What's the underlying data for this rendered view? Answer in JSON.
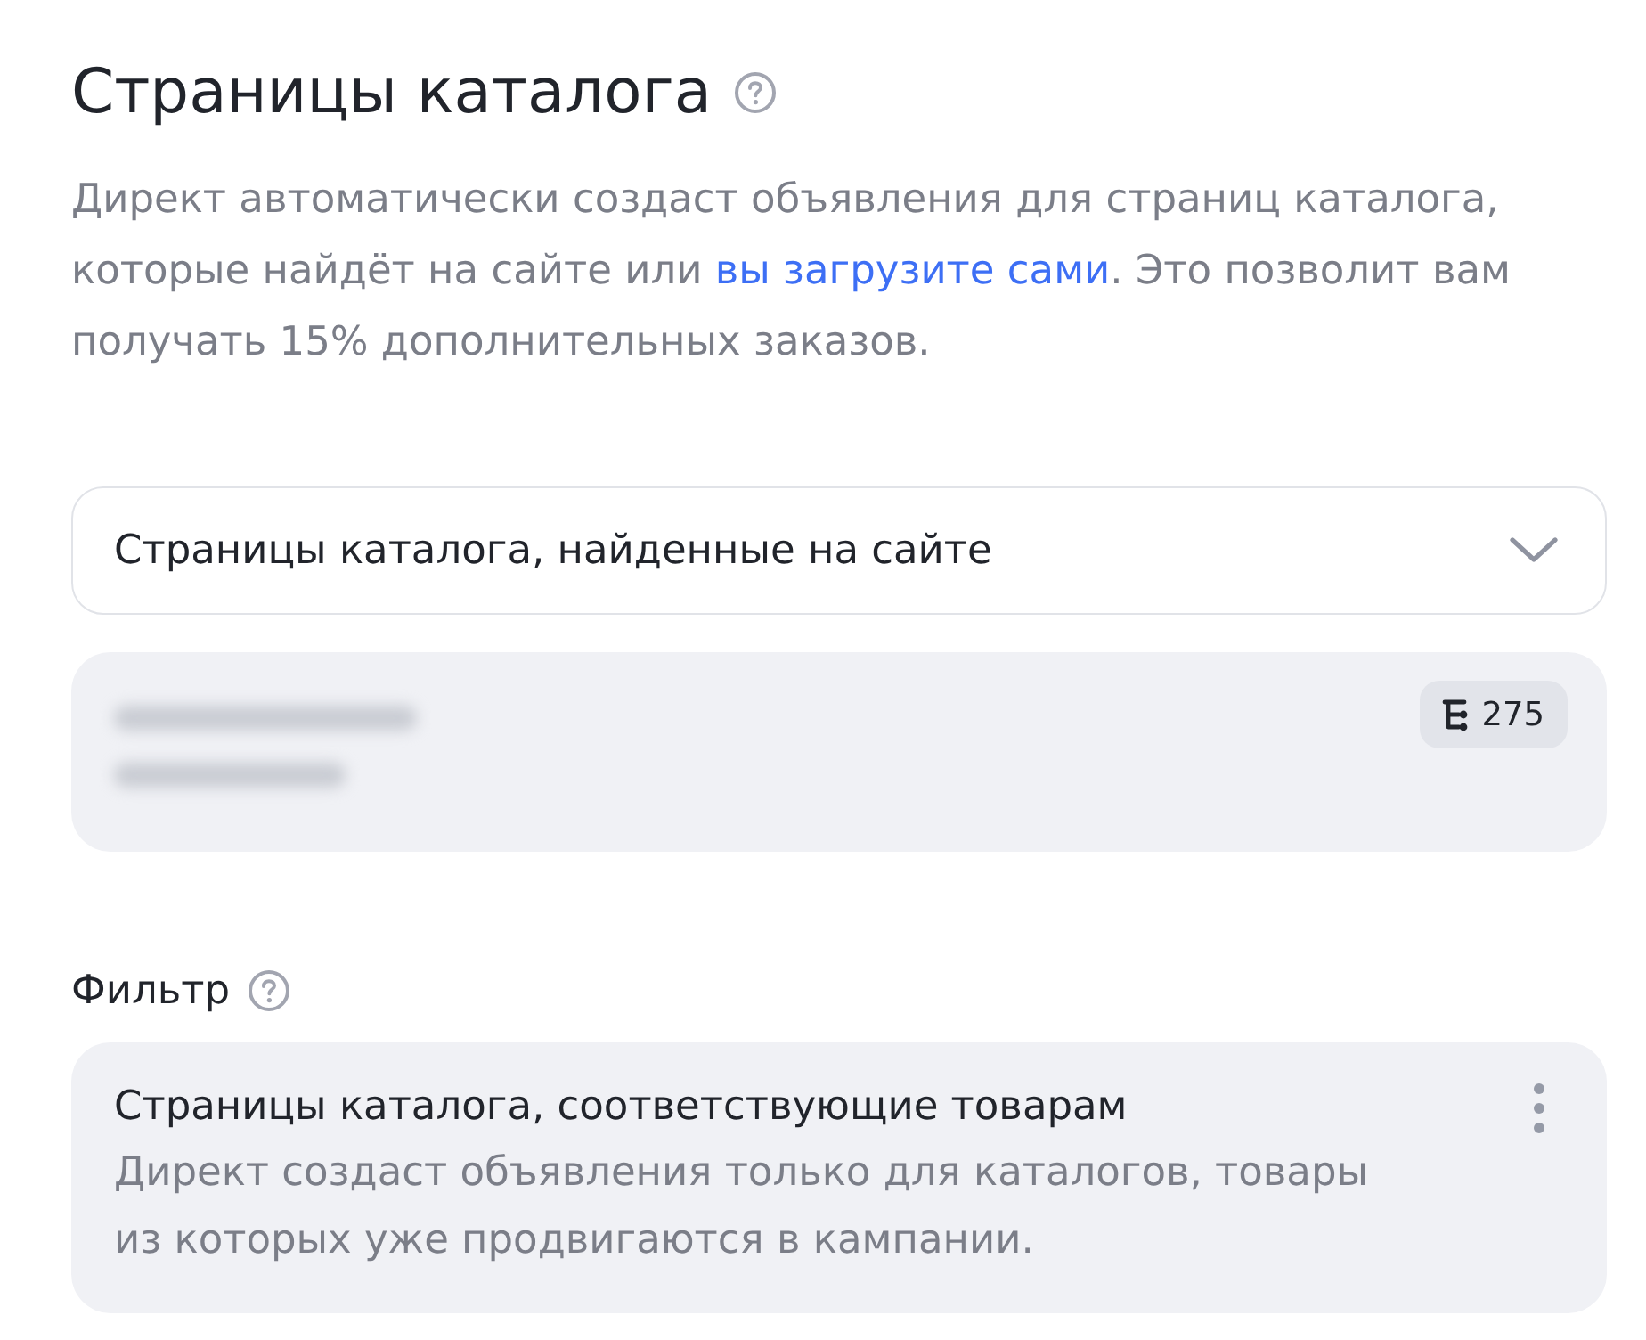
{
  "section": {
    "title": "Страницы каталога",
    "description": {
      "before": "Директ автоматически создаст объявления для страниц каталога, которые найдёт на сайте или ",
      "link": "вы загрузите сами",
      "after": ". Это позволит вам получать 15% дополнительных заказов."
    }
  },
  "source_select": {
    "value": "Страницы каталога, найденные на сайте"
  },
  "site_card": {
    "page_count": "275"
  },
  "filter": {
    "label": "Фильтр",
    "option": {
      "title": "Страницы каталога, соответствующие товарам",
      "description": "Директ создаст объявления только для каталогов, товары из которых уже продвигаются в кампании."
    }
  }
}
